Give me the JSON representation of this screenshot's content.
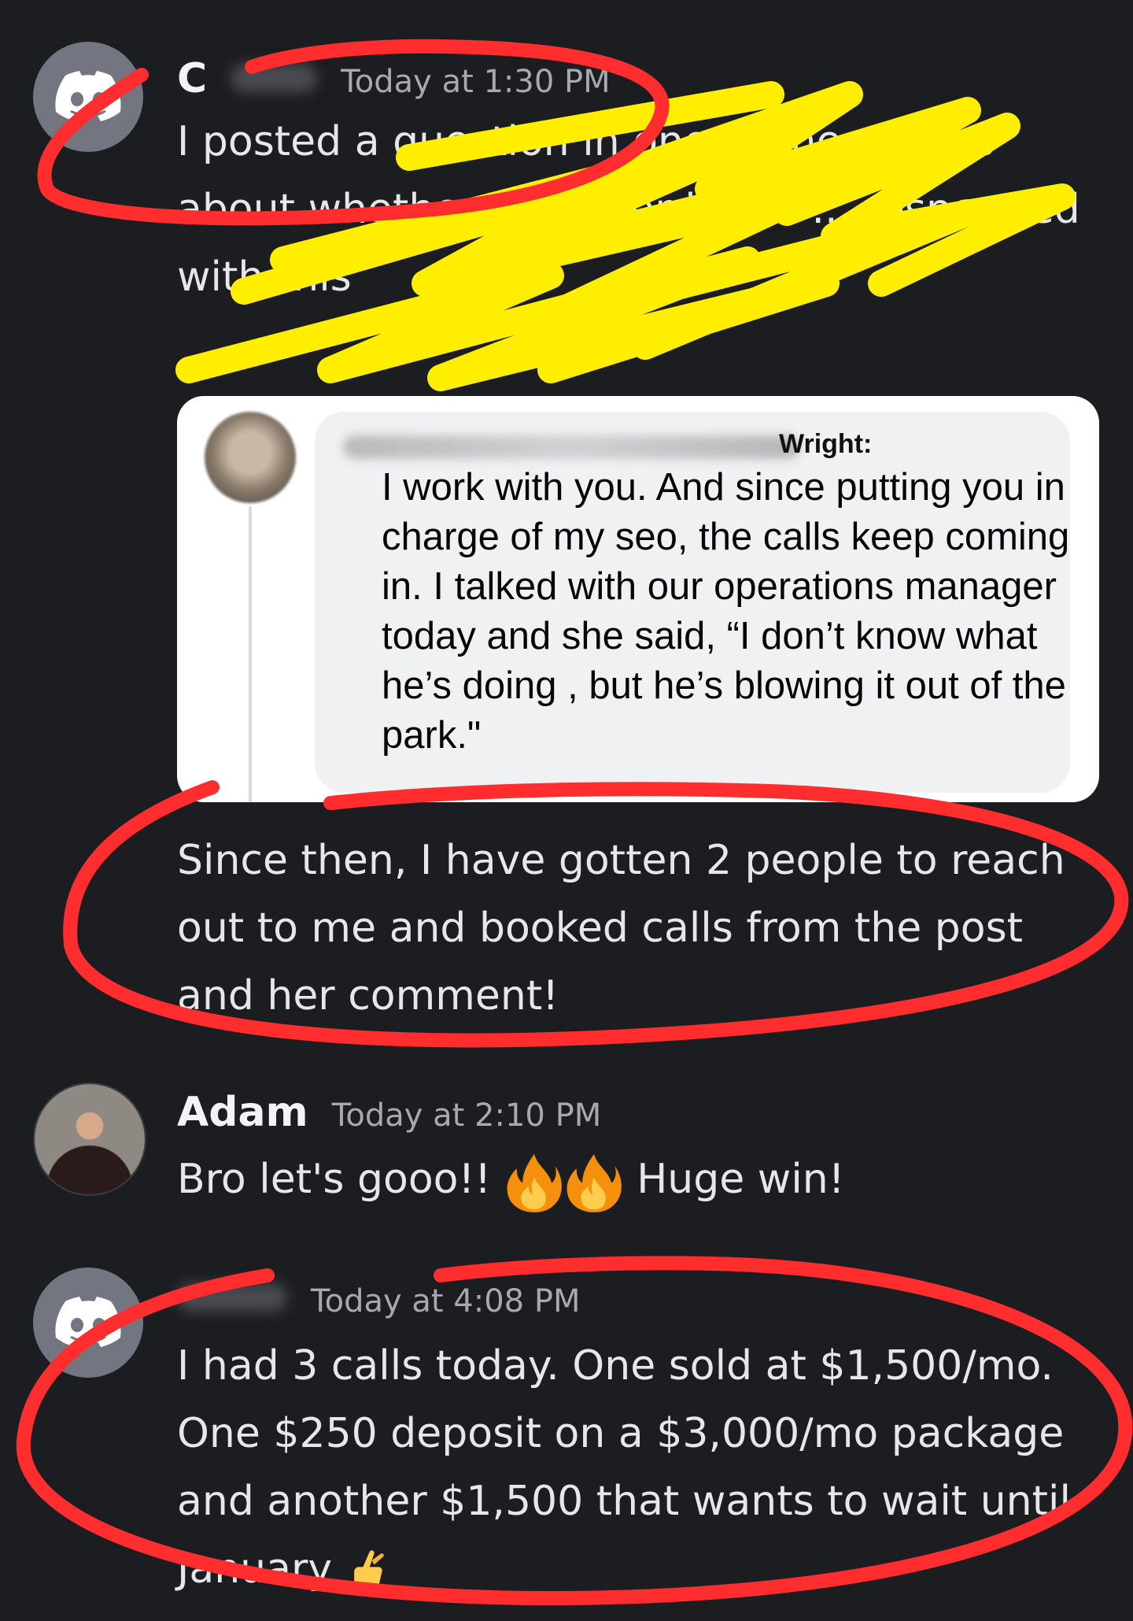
{
  "messages": [
    {
      "author": "C",
      "timestamp": "Today at 1:30 PM",
      "text": "I posted a question in one of the groups about whether you ... or if you ... responded with this"
    },
    {
      "embed": {
        "name": "Wright:",
        "text": "I work with you.  And since putting you in charge of my seo, the calls keep coming in. I talked with our operations manager today and she said, “I don’t know what he’s doing , but he’s blowing it out of the park.\""
      },
      "text": "Since then, I have gotten 2 people to reach out to me and booked calls from the post and her comment!"
    },
    {
      "author": "Adam",
      "timestamp": "Today at 2:10 PM",
      "text_before": "Bro let's gooo!!",
      "text_after": "Huge win!",
      "emojis": [
        "fire-emoji",
        "fire-emoji"
      ]
    },
    {
      "author": "",
      "timestamp": "Today at 4:08 PM",
      "text": "I had 3 calls today. One sold at $1,500/mo. One $250 deposit on a $3,000/mo package and another $1,500 that wants to wait until January",
      "emoji": "crossed-fingers-emoji"
    }
  ],
  "colors": {
    "background": "#1c1d21",
    "discord_avatar": "#737680",
    "annotation_red": "#ff2d2d",
    "scribble_yellow": "#ffee00"
  }
}
